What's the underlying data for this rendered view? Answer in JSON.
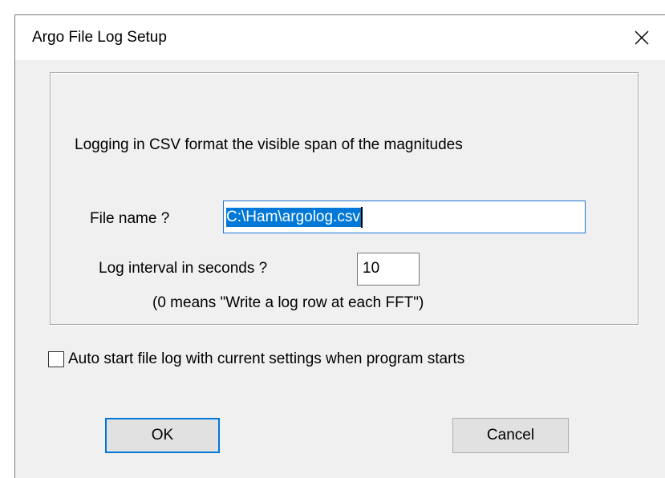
{
  "window": {
    "title": "Argo File Log Setup",
    "close_glyph": "✕"
  },
  "group": {
    "description": "Logging in CSV format the visible span of the magnitudes",
    "filename_label": "File name ?",
    "filename_value": "C:\\Ham\\argolog.csv",
    "interval_label": "Log interval in seconds ?",
    "interval_value": "10",
    "interval_note": "(0 means \"Write a log row at each FFT\")"
  },
  "autostart": {
    "checked": false,
    "label": "Auto start file log with current settings when program starts"
  },
  "buttons": {
    "ok_label": "OK",
    "cancel_label": "Cancel"
  },
  "colors": {
    "selection": "#0078d7",
    "focus_border": "#0078d7",
    "dialog_bg": "#f0f0f0"
  },
  "icons": {
    "close": "close-icon"
  }
}
